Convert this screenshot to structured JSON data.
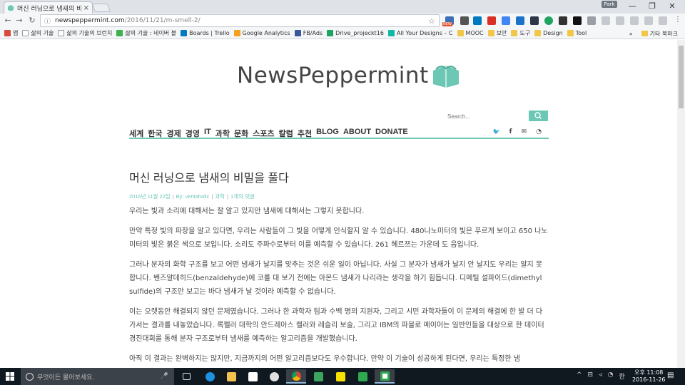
{
  "browser": {
    "tab_title": "머신 러닝으로 냄새의 비",
    "tab_close": "×",
    "profile_label": "Park",
    "window_min": "—",
    "window_restore": "❐",
    "window_close": "✕",
    "url_host": "newspeppermint.com",
    "url_path": "/2016/11/21/m-smell-2/",
    "back": "←",
    "forward": "→",
    "reload": "↻",
    "star": "☆",
    "menu": "⋮",
    "new_badge": "NEW"
  },
  "bookmarks": {
    "items": [
      {
        "label": "앱",
        "color": "#d94b3a"
      },
      {
        "label": "삶의 기술",
        "color": "#ffffff"
      },
      {
        "label": "삶의 기술의 브런치",
        "color": "#ffffff"
      },
      {
        "label": "삶의 기술 : 네이버 블",
        "color": "#3cb34a"
      },
      {
        "label": "Boards | Trello",
        "color": "#0079bf"
      },
      {
        "label": "Google Analytics",
        "color": "#f4a21d"
      },
      {
        "label": "FB/Ads",
        "color": "#3b5998"
      },
      {
        "label": "Drive_projeckt16",
        "color": "#1fa463"
      },
      {
        "label": "All Your Designs – C",
        "color": "#14b8a6"
      },
      {
        "label": "MOOC",
        "color": "#f1c74a"
      },
      {
        "label": "보안",
        "color": "#f1c74a"
      },
      {
        "label": "도구",
        "color": "#f1c74a"
      },
      {
        "label": "Design",
        "color": "#f1c74a"
      },
      {
        "label": "Tool",
        "color": "#f1c74a"
      }
    ],
    "overflow": "»",
    "other": "기타 북마크"
  },
  "site": {
    "logo_text": "NewsPeppermint",
    "accent": "#6cc7b5",
    "search_placeholder": "Search...",
    "nav": [
      "세계",
      "한국",
      "경제",
      "경영",
      "IT",
      "과학",
      "문화",
      "스포츠",
      "칼럼",
      "추천",
      "BLOG",
      "ABOUT",
      "DONATE"
    ],
    "social": {
      "twitter": "🐦",
      "facebook": "f",
      "email": "✉",
      "rss": "◔"
    }
  },
  "article": {
    "title": "머신 러닝으로 냄새의 비밀을 풀다",
    "meta_date": "2016년 11월 22일",
    "meta_by": "By: veritaholic",
    "meta_category": "과학",
    "meta_comments": "1개의 댓글",
    "paragraphs": [
      "우리는 빛과 소리에 대해서는 잘 알고 있지만 냄새에 대해서는 그렇지 못합니다.",
      "만약 특정 빛의 파장을 알고 있다면, 우리는 사람들이 그 빛을 어떻게 인식할지 알 수 있습니다. 480나노미터의 빛은 푸르게 보이고 650 나노미터의 빛은 붉은 색으로 보입니다. 소리도 주파수로부터 이를 예측할 수 있습니다. 261 헤르쯔는 가운데 도 음입니다.",
      "그러나 분자의 화학 구조를 보고 어떤 냄새가 날지를 맞추는 것은 쉬운 일이 아닙니다. 사실 그 분자가 냄새가 날지 안 날지도 우리는 알지 못합니다. 벤즈알데히드(benzaldehyde)에 코를 대 보기 전에는 아몬드 냄새가 나리라는 생각을 하기 힘듭니다. 디메틸 설파이드(dimethyl sulfide)의 구조만 보고는 바다 냄새가 날 것이라 예측할 수 없습니다.",
      "이는 오랫동안 해결되지 않던 문제였습니다. 그러나 한 과학자 팀과 수백 명의 지원자, 그리고 시민 과학자들이 이 문제의 해결에 한 발 더 다가서는 결과를 내놓았습니다. 록펠러 대학의 안드레아스 켈러와 레슬리 보술, 그리고 IBM의 파블로 메이어는 일반인들을 대상으로 한 데이터 경진대회를 통해 분자 구조로부터 냄새를 예측하는 알고리즘을 개발했습니다.",
      "아직 이 결과는 완벽하지는 않지만, 지금까지의 어떤 알고리즘보다도 우수합니다. 만약 이 기술이 성공하게 된다면, 우리는 특정한 냄"
    ]
  },
  "taskbar": {
    "search_placeholder": "무엇이든 물어보세요.",
    "mic": "🎤",
    "time": "오후 11:08",
    "date": "2016-11-26",
    "tray_icons": [
      "^",
      "⊟",
      "◃",
      "◔",
      "한"
    ],
    "notification": "▤"
  }
}
